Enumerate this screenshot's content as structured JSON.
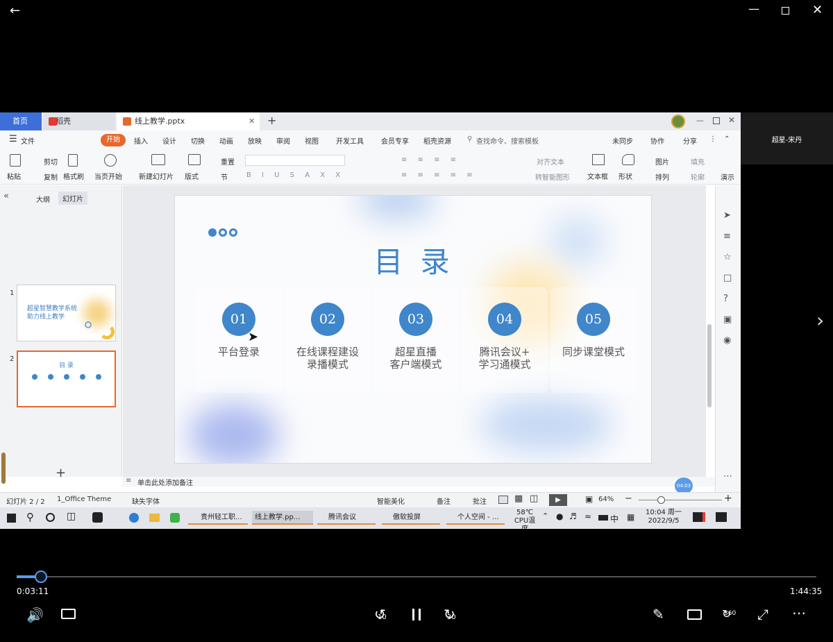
{
  "player": {
    "current_time": "0:03:11",
    "total_time": "1:44:35",
    "progress": 0.0305,
    "participant_name": "超星-宋丹",
    "skip_back_label": "10",
    "skip_fwd_label": "30",
    "vr_label": "360"
  },
  "wps": {
    "tabs": {
      "home": "首页",
      "daoke": "稻壳",
      "file": "线上教学.pptx"
    },
    "menu": {
      "file": "文件",
      "items": [
        "开始",
        "插入",
        "设计",
        "切换",
        "动画",
        "放映",
        "审阅",
        "视图",
        "开发工具",
        "会员专享",
        "稻壳资源"
      ],
      "search": "查找命令、搜索模板",
      "unsynced": "未同步",
      "collab": "协作",
      "share": "分享"
    },
    "ribbon": {
      "paste": "粘贴",
      "cut": "剪切",
      "copy": "复制",
      "format_painter": "格式刷",
      "play_from_current": "当页开始",
      "new_slide": "新建幻灯片",
      "layout": "版式",
      "section": "节",
      "reset": "重置",
      "align_text": "对齐文本",
      "smart_art": "转智能图形",
      "textbox": "文本框",
      "shape": "形状",
      "picture": "图片",
      "arrange": "排列",
      "fill": "填充",
      "outline": "轮廓",
      "more": "演示"
    },
    "panel": {
      "outline_tab": "大纲",
      "slides_tab": "幻灯片",
      "slide1_num": "1",
      "slide2_num": "2",
      "thumb1_line1": "超星智慧教学系统",
      "thumb1_line2": "助力线上教学",
      "thumb2_title": "目 录"
    },
    "slide": {
      "title": "目  录",
      "items": [
        {
          "num": "01",
          "line1": "平台登录",
          "line2": ""
        },
        {
          "num": "02",
          "line1": "在线课程建设",
          "line2": "录播模式"
        },
        {
          "num": "03",
          "line1": "超星直播",
          "line2": "客户端模式"
        },
        {
          "num": "04",
          "line1": "腾讯会议+",
          "line2": "学习通模式"
        },
        {
          "num": "05",
          "line1": "同步课堂模式",
          "line2": ""
        }
      ]
    },
    "notes_placeholder": "单击此处添加备注",
    "timer_badge": "04:03",
    "status": {
      "slide_index": "幻灯片 2 / 2",
      "theme": "1_Office Theme",
      "missing_font": "缺失字体",
      "smart_beautify": "智能美化",
      "notes": "备注",
      "comments": "批注",
      "zoom": "64%"
    },
    "taskbar": {
      "apps": [
        "贵州轻工职...",
        "线上教学.pp...",
        "腾讯会议",
        "傲软投屏",
        "个人空间 - ..."
      ],
      "temp": "58℃",
      "temp_label": "CPU温度",
      "ime": "中",
      "time": "10:04 周一",
      "date": "2022/9/5"
    }
  }
}
